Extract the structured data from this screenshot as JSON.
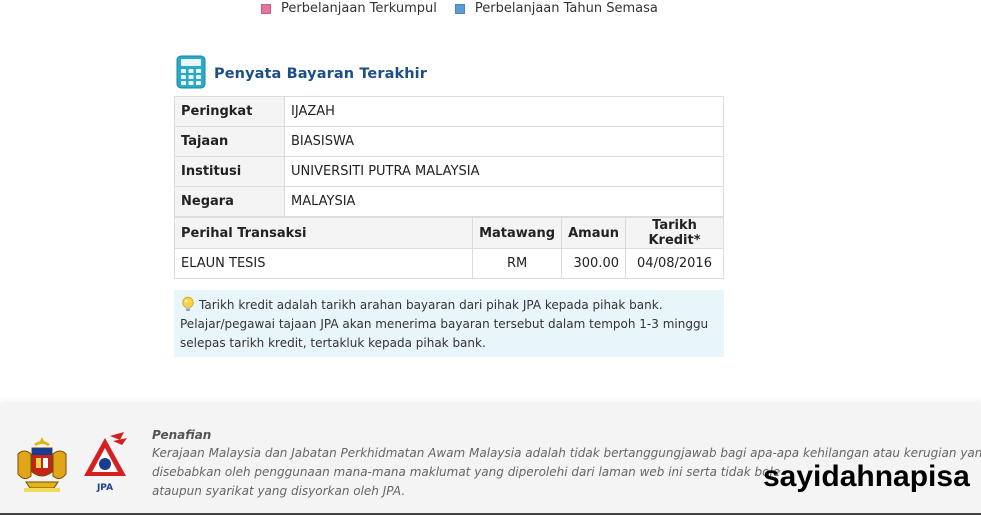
{
  "legend": {
    "items": [
      {
        "label": "Perbelanjaan Terkumpul",
        "color": "#e8739f"
      },
      {
        "label": "Perbelanjaan Tahun Semasa",
        "color": "#5b9bd5"
      }
    ]
  },
  "panel": {
    "title": "Penyata Bayaran Terakhir",
    "icon": "calculator-icon"
  },
  "info": {
    "rows": [
      {
        "key": "Peringkat",
        "value": "IJAZAH"
      },
      {
        "key": "Tajaan",
        "value": "BIASISWA"
      },
      {
        "key": "Institusi",
        "value": "UNIVERSITI PUTRA MALAYSIA"
      },
      {
        "key": "Negara",
        "value": "MALAYSIA"
      }
    ]
  },
  "transactions": {
    "headers": {
      "desc": "Perihal Transaksi",
      "currency": "Matawang",
      "amount": "Amaun",
      "date": "Tarikh Kredit*"
    },
    "rows": [
      {
        "desc": "ELAUN TESIS",
        "currency": "RM",
        "amount": "300.00",
        "date": "04/08/2016"
      }
    ]
  },
  "note": {
    "icon": "lightbulb-icon",
    "text": "Tarikh kredit adalah tarikh arahan bayaran dari pihak JPA kepada pihak bank. Pelajar/pegawai tajaan JPA akan menerima bayaran tersebut dalam tempoh 1-3 minggu selepas tarikh kredit, tertakluk kepada pihak bank."
  },
  "footer": {
    "disclaimer_title": "Penafian",
    "disclaimer_lines": [
      "Kerajaan Malaysia dan Jabatan Perkhidmatan Awam Malaysia adalah tidak bertanggungjawab bagi apa-apa kehilangan atau kerugian yang",
      "disebabkan oleh penggunaan mana-mana maklumat yang diperolehi dari laman web ini serta tidak bole",
      "ataupun syarikat yang disyorkan oleh JPA."
    ],
    "jpa_label": "JPA",
    "watermark": "sayidahnapisa"
  }
}
